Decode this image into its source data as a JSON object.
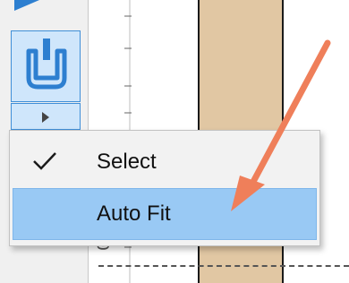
{
  "context_menu": {
    "items": [
      {
        "label": "Select",
        "checked": true
      },
      {
        "label": "Auto Fit",
        "highlighted": true
      }
    ]
  },
  "ruler": {
    "label": "0"
  },
  "colors": {
    "accent": "#3f8fd8",
    "highlight": "#99c9f4",
    "beam": "#e1c7a3",
    "arrow": "#ef7f5a"
  }
}
